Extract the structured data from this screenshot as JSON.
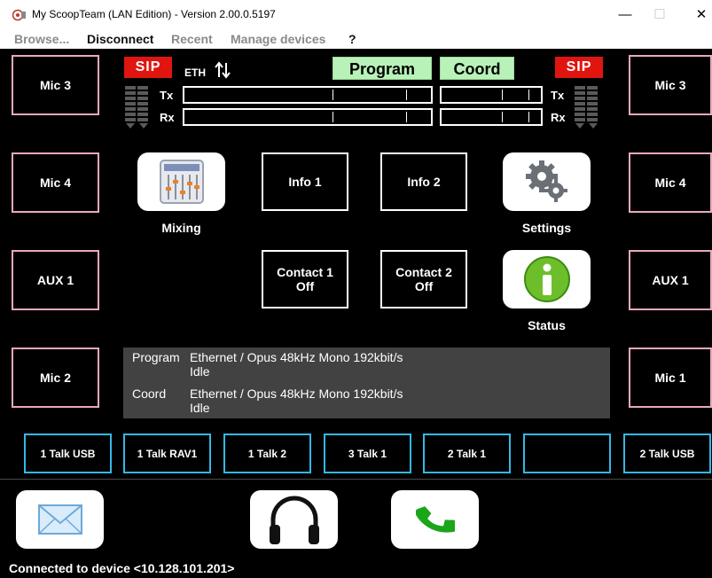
{
  "window": {
    "title": "My ScoopTeam (LAN Edition) - Version 2.00.0.5197",
    "minimize": "—",
    "maximize": "☐",
    "close": "✕"
  },
  "menu": {
    "browse": "Browse...",
    "disconnect": "Disconnect",
    "recent": "Recent",
    "manage": "Manage devices",
    "help": "?"
  },
  "header": {
    "sip_left": "SIP",
    "sip_right": "SIP",
    "eth": "ETH",
    "program": "Program",
    "coord": "Coord",
    "tx_left": "Tx",
    "rx_left": "Rx",
    "tx_right": "Tx",
    "rx_right": "Rx"
  },
  "left_buttons": [
    "Mic 3",
    "Mic 4",
    "AUX 1",
    "Mic 2"
  ],
  "right_buttons": [
    "Mic 3",
    "Mic 4",
    "AUX 1",
    "Mic 1"
  ],
  "center": {
    "mixing": "Mixing",
    "info1": "Info 1",
    "info2": "Info 2",
    "settings": "Settings",
    "contact1_line1": "Contact 1",
    "contact1_line2": "Off",
    "contact2_line1": "Contact 2",
    "contact2_line2": "Off",
    "status": "Status"
  },
  "info_panel": {
    "program_label": "Program",
    "program_line1": "Ethernet / Opus 48kHz Mono 192kbit/s",
    "program_line2": "Idle",
    "coord_label": "Coord",
    "coord_line1": "Ethernet / Opus 48kHz Mono 192kbit/s",
    "coord_line2": "Idle"
  },
  "talk_buttons": [
    "1 Talk USB",
    "1 Talk RAV1",
    "1 Talk 2",
    "3 Talk 1",
    "2 Talk 1",
    "",
    "2 Talk USB"
  ],
  "status_bar": "Connected to device <10.128.101.201>",
  "colors": {
    "sip_red": "#e0150f",
    "tab_green": "#b8f2b8",
    "side_border_pink": "#e9a8c0",
    "talk_border_blue": "#35b8e8",
    "call_green": "#1aa51a",
    "info_green": "#6cbf2a"
  },
  "icons": [
    "app-icon",
    "eth-arrows-icon",
    "mixer-icon",
    "gears-icon",
    "info-icon",
    "envelope-icon",
    "headphones-icon",
    "phone-icon"
  ]
}
